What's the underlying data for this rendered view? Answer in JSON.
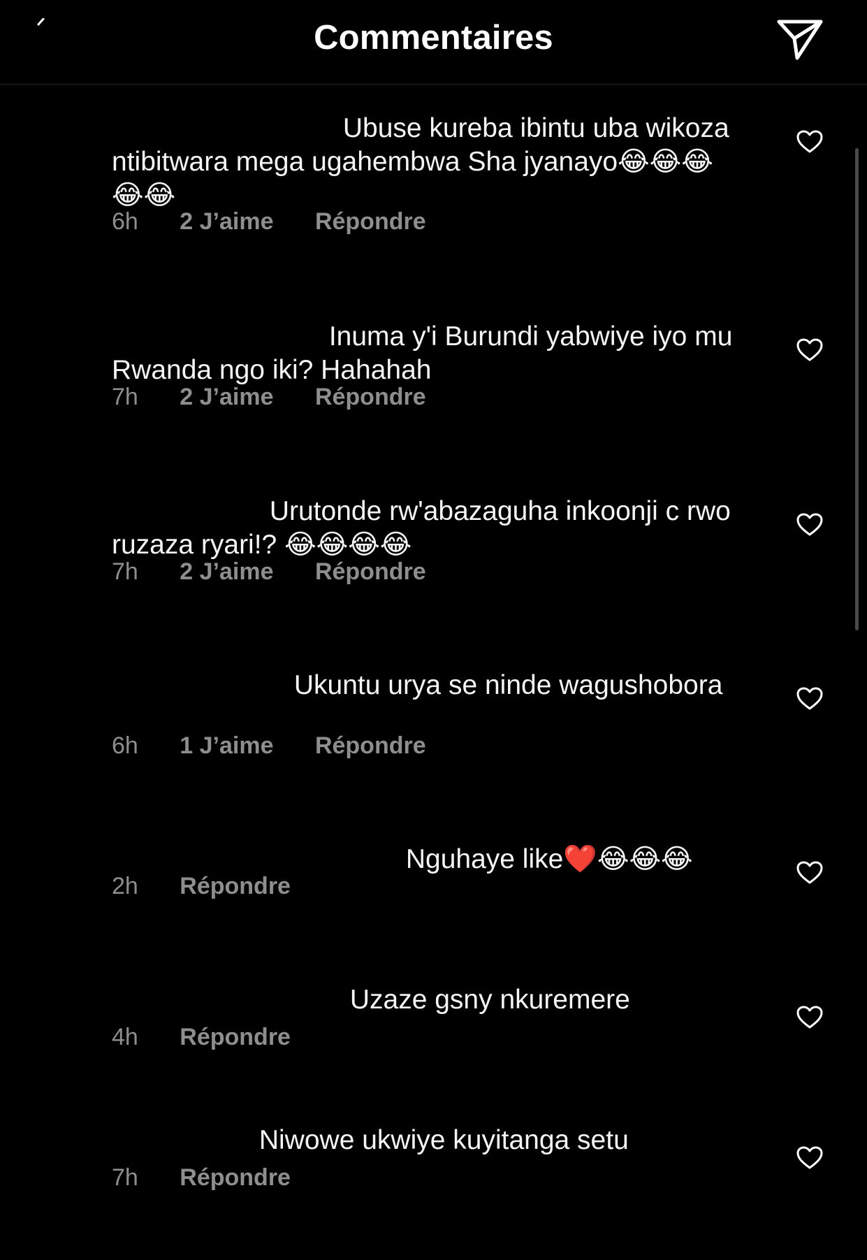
{
  "header": {
    "title": "Commentaires"
  },
  "comments": [
    {
      "text": "Ubuse kureba ibintu uba wikoza ntibitwara mega ugahembwa Sha jyanayo😂😂😂😂😂",
      "time": "6h",
      "likes": "2 J’aime",
      "reply": "Répondre"
    },
    {
      "text": "Inuma y'i Burundi yabwiye iyo mu Rwanda ngo iki? Hahahah",
      "time": "7h",
      "likes": "2 J’aime",
      "reply": "Répondre"
    },
    {
      "text": "Urutonde rw'abazaguha inkoonji c rwo ruzaza ryari!? 😂😂😂😂",
      "time": "7h",
      "likes": "2 J’aime",
      "reply": "Répondre"
    },
    {
      "text": "Ukuntu urya se ninde wagushobora",
      "time": "6h",
      "likes": "1 J’aime",
      "reply": "Répondre"
    },
    {
      "text": "Nguhaye like❤️😂😂😂",
      "time": "2h",
      "likes": "",
      "reply": "Répondre"
    },
    {
      "text": "Uzaze gsny  nkuremere",
      "time": "4h",
      "likes": "",
      "reply": "Répondre"
    },
    {
      "text": "Niwowe ukwiye kuyitanga setu",
      "time": "7h",
      "likes": "",
      "reply": "Répondre"
    }
  ],
  "icons": {
    "share": "paper-plane-icon",
    "like": "heart-outline-icon"
  },
  "colors": {
    "background": "#000000",
    "text": "#f5f5f5",
    "meta": "#8e8e8e"
  }
}
